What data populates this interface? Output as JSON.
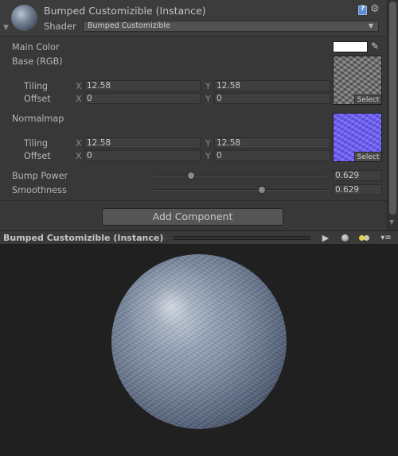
{
  "header": {
    "title": "Bumped Customizible (Instance)",
    "shader_label": "Shader",
    "shader_value": "Bumped Customizible"
  },
  "properties": {
    "main_color_label": "Main Color",
    "main_color": "#ffffff",
    "base_label": "Base (RGB)",
    "base": {
      "tiling_label": "Tiling",
      "offset_label": "Offset",
      "tiling_x": "12.58",
      "tiling_y": "12.58",
      "offset_x": "0",
      "offset_y": "0",
      "select_label": "Select"
    },
    "normalmap_label": "Normalmap",
    "normalmap": {
      "tiling_label": "Tiling",
      "offset_label": "Offset",
      "tiling_x": "12.58",
      "tiling_y": "12.58",
      "offset_x": "0",
      "offset_y": "0",
      "select_label": "Select"
    },
    "axis_x": "X",
    "axis_y": "Y",
    "bump_power_label": "Bump Power",
    "bump_power_value": "0.629",
    "smoothness_label": "Smoothness",
    "smoothness_value": "0.629"
  },
  "add_component_label": "Add Component",
  "preview": {
    "title": "Bumped Customizible (Instance)",
    "play_icon": "▶",
    "menu_icon": "▾≡"
  },
  "icons": {
    "help": "book-help-icon",
    "settings": "gear-icon",
    "picker": "eyedropper-icon"
  }
}
